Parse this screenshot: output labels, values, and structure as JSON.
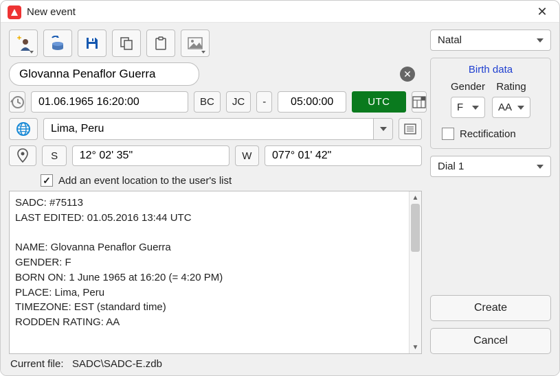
{
  "window": {
    "title": "New event"
  },
  "name": "Glovanna Penaflor Guerra",
  "datetime": {
    "value": "01.06.1965 16:20:00",
    "bc": "BC",
    "jc": "JC",
    "sign": "-",
    "offset": "05:00:00",
    "utc": "UTC"
  },
  "location": {
    "place": "Lima, Peru",
    "lat_hemi": "S",
    "lat": "12° 02' 35\"",
    "lon_hemi": "W",
    "lon": "077° 01' 42\""
  },
  "add_to_list": {
    "label": "Add an event location to the user's list",
    "checked": true
  },
  "notes": "SADC: #75113\nLAST EDITED: 01.05.2016 13:44 UTC\n\nNAME: Glovanna Penaflor Guerra\nGENDER: F\nBORN ON: 1 June 1965 at 16:20 (= 4:20 PM)\nPLACE: Lima, Peru\nTIMEZONE: EST (standard time)\nRODDEN RATING: AA",
  "right": {
    "event_type": "Natal",
    "birth_data_title": "Birth data",
    "gender_label": "Gender",
    "rating_label": "Rating",
    "gender": "F",
    "rating": "AA",
    "rectification": "Rectification",
    "rectification_checked": false,
    "dial": "Dial 1",
    "create": "Create",
    "cancel": "Cancel"
  },
  "footer": {
    "label": "Current file:",
    "value": "SADC\\SADC-E.zdb"
  }
}
